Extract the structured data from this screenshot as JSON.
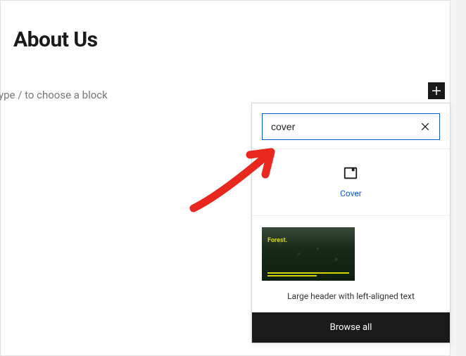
{
  "page": {
    "title": "About Us"
  },
  "editor": {
    "placeholder": "ype / to choose a block"
  },
  "inserter": {
    "search_value": "cover",
    "block_result": {
      "label": "Cover",
      "icon": "cover-icon"
    },
    "pattern_result": {
      "preview_text": "Forest.",
      "title": "Large header with left-aligned text"
    },
    "browse_all_label": "Browse all"
  }
}
